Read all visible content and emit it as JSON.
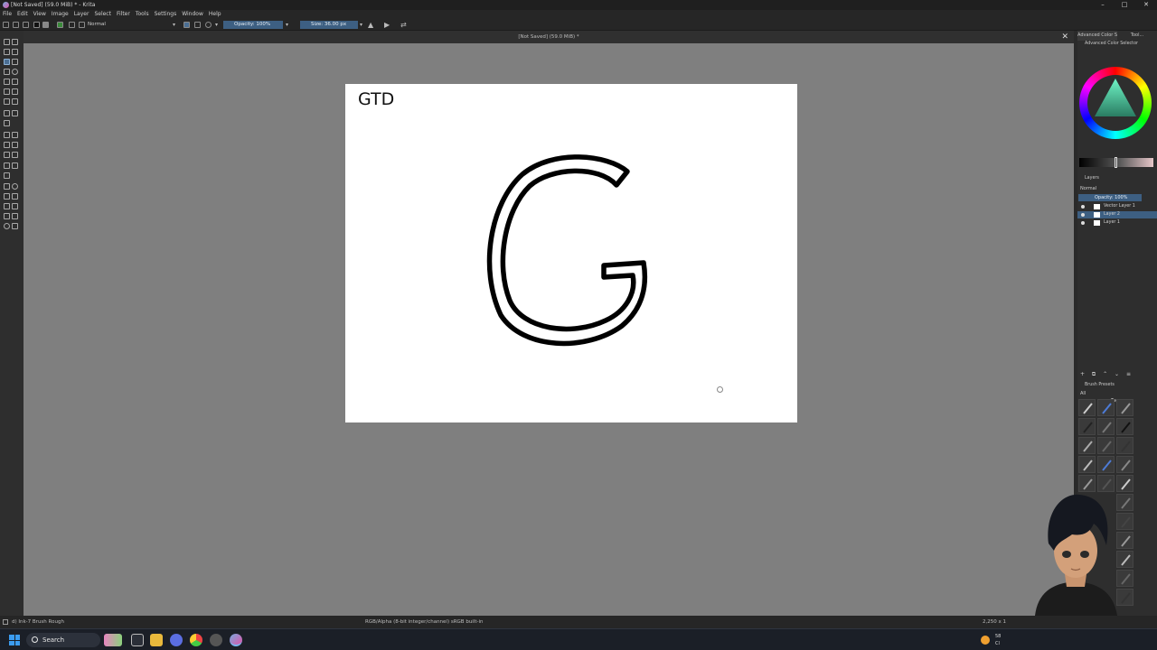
{
  "window": {
    "title": "[Not Saved]  (59.0 MiB) * - Krita",
    "controls": [
      "–",
      "□",
      "✕"
    ]
  },
  "menu": [
    "File",
    "Edit",
    "View",
    "Image",
    "Layer",
    "Select",
    "Filter",
    "Tools",
    "Settings",
    "Window",
    "Help"
  ],
  "toolbar": {
    "blend_mode": "Normal",
    "opacity_label": "Opacity: 100%",
    "size_label": "Size: 36.00 px"
  },
  "document_tab": {
    "title": "[Not Saved]  (59.0 MiB) *",
    "close": "✕"
  },
  "canvas": {
    "text": "GTD"
  },
  "dock": {
    "tabs": [
      "Advanced Color S...",
      "Tool..."
    ],
    "color_selector_title": "Advanced Color Selector",
    "layers_title": "Layers",
    "layer_mode": "Normal",
    "layer_opacity": "Opacity: 100%",
    "layers": [
      {
        "name": "Vector Layer 1",
        "selected": false
      },
      {
        "name": "Layer 2",
        "selected": true
      },
      {
        "name": "Layer 1",
        "selected": false
      }
    ],
    "layer_buttons": "+ ⧉ ⌃ ⌄ ≡",
    "brush_presets_title": "Brush Presets",
    "brush_filter": "All",
    "brush_tag": "Tag"
  },
  "status": {
    "brush": "d) Ink-7 Brush Rough",
    "colorspace": "RGB/Alpha (8-bit integer/channel)  sRGB built-in",
    "dims": "2,250 x 1"
  },
  "taskbar": {
    "search_placeholder": "Search",
    "tray_top": "58",
    "tray_bottom": "Cl"
  }
}
